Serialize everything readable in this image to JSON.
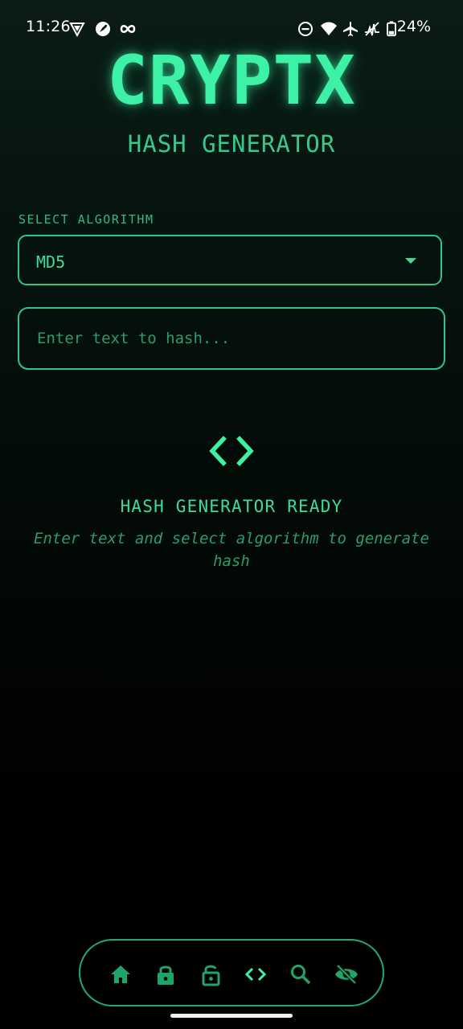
{
  "status_bar": {
    "time": "11:26",
    "battery": "24%",
    "icons": [
      "vpn-shield-icon",
      "rocket-badge-icon",
      "infinity-icon",
      "do-not-disturb-icon",
      "wifi-icon",
      "airplane-icon",
      "signal-off-icon",
      "battery-icon"
    ]
  },
  "header": {
    "title": "CRYPTX",
    "subtitle": "HASH GENERATOR"
  },
  "form": {
    "select_label": "SELECT ALGORITHM",
    "algorithm": "MD5",
    "input_placeholder": "Enter text to hash...",
    "input_value": ""
  },
  "empty_state": {
    "icon": "code-icon",
    "title": "HASH GENERATOR READY",
    "subtitle": "Enter text and select algorithm to generate hash"
  },
  "bottom_nav": {
    "items": [
      {
        "icon": "home-icon"
      },
      {
        "icon": "lock-icon"
      },
      {
        "icon": "unlock-icon"
      },
      {
        "icon": "code-icon",
        "active": true
      },
      {
        "icon": "search-icon"
      },
      {
        "icon": "eye-off-icon"
      }
    ]
  },
  "colors": {
    "accent": "#3df2a6",
    "accent_dim": "#2a9c6a",
    "border": "#2fc585",
    "background_top": "#0a1c15",
    "background_bottom": "#000000"
  }
}
